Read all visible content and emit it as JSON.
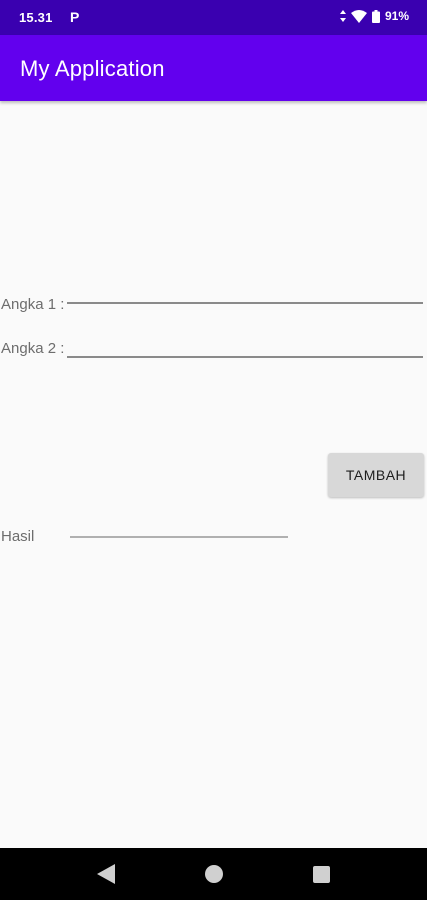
{
  "status_bar": {
    "time": "15.31",
    "notification_icon": "p-icon",
    "battery_percent": "91%",
    "icons": [
      "data-arrows-icon",
      "wifi-icon",
      "battery-icon"
    ]
  },
  "app_bar": {
    "title": "My Application",
    "color": "#6200ee"
  },
  "form": {
    "angka1_label": "Angka 1 :",
    "angka1_value": "",
    "angka2_label": "Angka 2 :",
    "angka2_value": "",
    "button_label": "TAMBAH",
    "hasil_label": "Hasil",
    "hasil_value": ""
  },
  "nav_bar": {
    "buttons": [
      "back-icon",
      "home-icon",
      "recents-icon"
    ]
  }
}
